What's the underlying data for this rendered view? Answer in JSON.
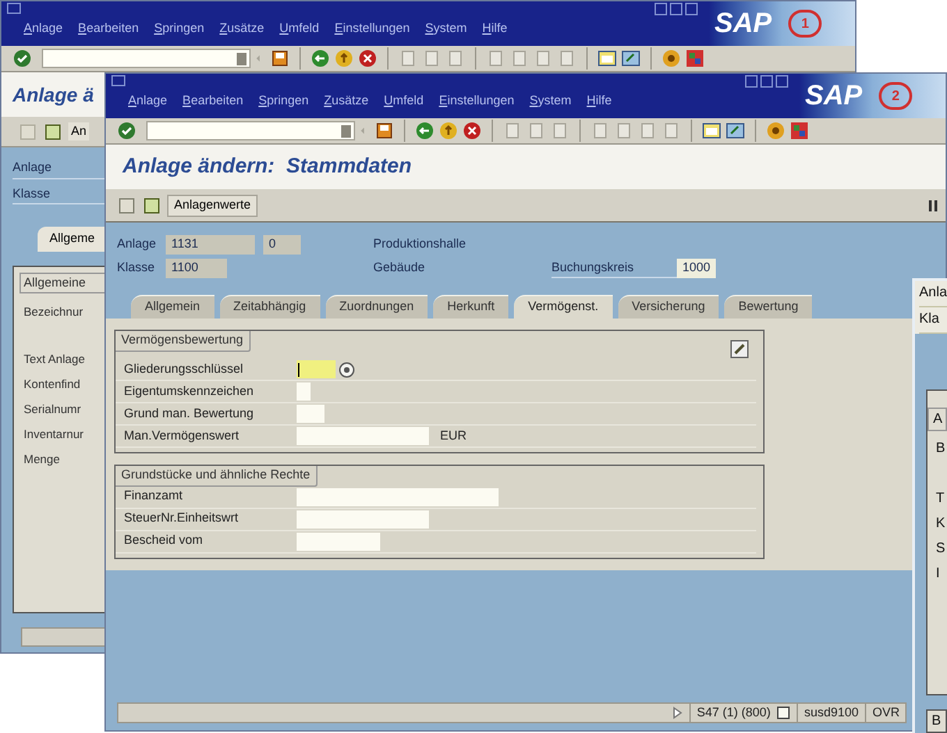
{
  "back_window": {
    "menu": [
      "Anlage",
      "Bearbeiten",
      "Springen",
      "Zusätze",
      "Umfeld",
      "Einstellungen",
      "System",
      "Hilfe"
    ],
    "logo": "SAP",
    "badge": "1",
    "title": "Anlage ä",
    "app_button": "An",
    "header_labels": [
      "Anlage",
      "Klasse"
    ],
    "tabs": [
      {
        "label": "Allgeme",
        "selected": true
      }
    ],
    "group_title": "Allgemeine",
    "labels": [
      "Bezeichnur",
      "Text Anlage",
      "Kontenfind",
      "Serialnumr",
      "Inventarnur",
      "Menge"
    ]
  },
  "front_window": {
    "menu": [
      "Anlage",
      "Bearbeiten",
      "Springen",
      "Zusätze",
      "Umfeld",
      "Einstellungen",
      "System",
      "Hilfe"
    ],
    "logo": "SAP",
    "badge": "2",
    "title": "Anlage ändern:  Stammdaten",
    "app_button": "Anlagenwerte",
    "header": {
      "anlage_label": "Anlage",
      "anlage": "1131",
      "sub_number": "0",
      "klasse_label": "Klasse",
      "klasse": "1100",
      "description": "Produktionshalle",
      "gebaeude_label": "Gebäude",
      "buchungskreis_label": "Buchungskreis",
      "buchungskreis": "1000"
    },
    "tabs": [
      {
        "label": "Allgemein",
        "selected": false
      },
      {
        "label": "Zeitabhängig",
        "selected": false
      },
      {
        "label": "Zuordnungen",
        "selected": false
      },
      {
        "label": "Herkunft",
        "selected": false
      },
      {
        "label": "Vermögenst.",
        "selected": true
      },
      {
        "label": "Versicherung",
        "selected": false
      },
      {
        "label": "Bewertung",
        "selected": false
      }
    ],
    "groups": [
      {
        "title": "Vermögensbewertung",
        "fields": [
          {
            "label": "Gliederungsschlüssel",
            "focused": true
          },
          {
            "label": "Eigentumskennzeichen",
            "focused": false
          },
          {
            "label": "Grund man. Bewertung",
            "focused": false
          },
          {
            "label": "Man.Vermögenswert",
            "focused": false,
            "unit": "EUR"
          }
        ]
      },
      {
        "title": "Grundstücke und ähnliche Rechte",
        "fields": [
          {
            "label": "Finanzamt",
            "focused": false
          },
          {
            "label": "SteuerNr.Einheitswrt",
            "focused": false
          },
          {
            "label": "Bescheid vom",
            "focused": false
          }
        ]
      }
    ],
    "status": {
      "system": "S47 (1) (800)",
      "server": "susd9100",
      "mode": "OVR"
    }
  },
  "right_window": {
    "header_labels": [
      "Anla",
      "Kla"
    ],
    "group_title": "A",
    "labels": [
      "B",
      "T",
      "K",
      "S",
      "I"
    ],
    "bottom_label": "B"
  }
}
